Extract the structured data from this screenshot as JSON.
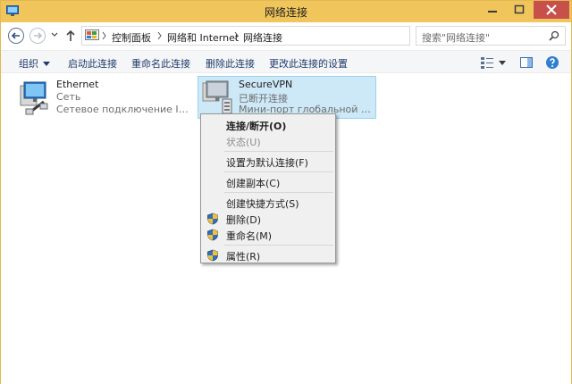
{
  "window": {
    "title": "网络连接",
    "colors": {
      "titlebar": "#f0c65c",
      "close": "#c7504b",
      "selection": "#cde8f7"
    }
  },
  "address": {
    "crumbs": [
      "控制面板",
      "网络和 Internet",
      "网络连接"
    ]
  },
  "search": {
    "placeholder": "搜索\"网络连接\""
  },
  "commands": {
    "organize": "组织",
    "start": "启动此连接",
    "rename": "重命名此连接",
    "delete": "删除此连接",
    "change": "更改此连接的设置"
  },
  "items": [
    {
      "name": "Ethernet",
      "status": "Сеть",
      "device": "Сетевое подключение Intel(R) ..."
    },
    {
      "name": "SecureVPN",
      "status": "已断开连接",
      "device": "Мини-порт глобальной сети ..."
    }
  ],
  "menu": {
    "items": [
      {
        "label": "连接/断开(O)",
        "bold": true,
        "disabled": false,
        "shield": false
      },
      {
        "label": "状态(U)",
        "bold": false,
        "disabled": true,
        "shield": false
      },
      {
        "label": "设置为默认连接(F)",
        "bold": false,
        "disabled": false,
        "shield": false
      },
      {
        "label": "创建副本(C)",
        "bold": false,
        "disabled": false,
        "shield": false
      },
      {
        "label": "创建快捷方式(S)",
        "bold": false,
        "disabled": false,
        "shield": false
      },
      {
        "label": "删除(D)",
        "bold": false,
        "disabled": false,
        "shield": true
      },
      {
        "label": "重命名(M)",
        "bold": false,
        "disabled": false,
        "shield": true
      },
      {
        "label": "属性(R)",
        "bold": false,
        "disabled": false,
        "shield": true
      }
    ]
  },
  "icons": {
    "app": "network-connections-icon",
    "back": "back-arrow-icon",
    "forward": "forward-arrow-icon",
    "up": "up-arrow-icon",
    "refresh": "refresh-icon",
    "search": "search-icon",
    "view": "view-options-icon",
    "pane": "preview-pane-icon",
    "help": "help-icon",
    "shield": "uac-shield-icon"
  }
}
